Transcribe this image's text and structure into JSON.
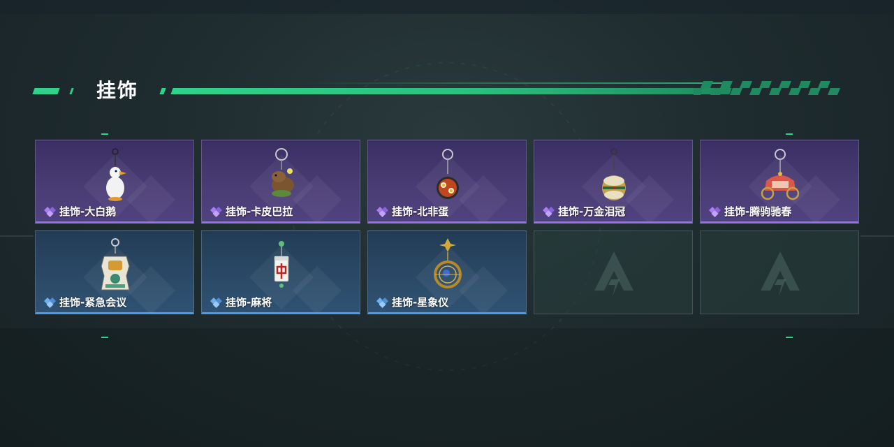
{
  "header": {
    "title": "挂饰"
  },
  "colors": {
    "accent": "#2fd28a",
    "rarity_epic": "#9a6cf0",
    "rarity_rare": "#4f9ae4"
  },
  "slots": [
    {
      "label": "挂饰-大白鹅",
      "rarity": "epic",
      "icon": "goose-charm-icon"
    },
    {
      "label": "挂饰-卡皮巴拉",
      "rarity": "epic",
      "icon": "capybara-charm-icon"
    },
    {
      "label": "挂饰-北非蛋",
      "rarity": "epic",
      "icon": "shakshuka-charm-icon"
    },
    {
      "label": "挂饰-万金泪冠",
      "rarity": "epic",
      "icon": "jeweled-crown-charm-icon"
    },
    {
      "label": "挂饰-腾驹驰春",
      "rarity": "epic",
      "icon": "carriage-charm-icon"
    },
    {
      "label": "挂饰-紧急会议",
      "rarity": "rare",
      "icon": "meeting-badge-charm-icon"
    },
    {
      "label": "挂饰-麻将",
      "rarity": "rare",
      "icon": "mahjong-tile-charm-icon"
    },
    {
      "label": "挂饰-星象仪",
      "rarity": "rare",
      "icon": "astrolabe-charm-icon"
    },
    {
      "label": "",
      "rarity": "empty",
      "icon": "empty-slot-logo-icon"
    },
    {
      "label": "",
      "rarity": "empty",
      "icon": "empty-slot-logo-icon"
    }
  ]
}
